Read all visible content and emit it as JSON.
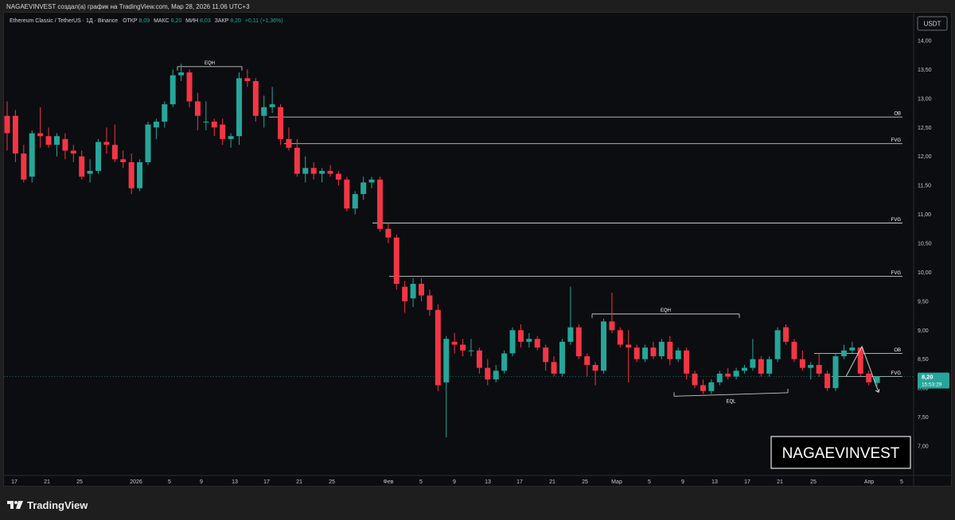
{
  "header": {
    "text": "NAGAEVINVEST создал(а) график на TradingView.com, Мар 28, 2026 11:06 UTC+3"
  },
  "footer": {
    "brand": "TradingView"
  },
  "colors": {
    "up": "#26a69a",
    "down": "#f23645",
    "level": "#c8c8c8",
    "axis_text": "#c8c8c8",
    "background": "#0c0d10",
    "price_badge": "#26a69a"
  },
  "chart_data": {
    "type": "candlestick",
    "legend": {
      "symbol": "Ethereum Classic / TetherUS · 1Д · Binance",
      "open_label": "ОТКР",
      "open": "8,09",
      "high_label": "МАКС",
      "high": "8,20",
      "low_label": "МИН",
      "low": "8,03",
      "close_label": "ЗАКР",
      "close": "8,20",
      "change": "+0,11 (+1,36%)"
    },
    "currency_button": "USDT",
    "y_ticks": [
      "7,00",
      "7,50",
      "8,00",
      "8,50",
      "9,00",
      "9,50",
      "10,00",
      "10,50",
      "11,00",
      "11,50",
      "12,00",
      "12,50",
      "13,00",
      "13,50",
      "14,00"
    ],
    "x_ticks": [
      "17",
      "21",
      "25",
      "2026",
      "5",
      "9",
      "13",
      "17",
      "21",
      "25",
      "Фев",
      "5",
      "9",
      "13",
      "17",
      "21",
      "25",
      "Мар",
      "5",
      "9",
      "13",
      "17",
      "21",
      "25",
      "Апр",
      "5"
    ],
    "ylim": [
      6.7,
      14.15
    ],
    "current_price": "8,20",
    "countdown": "15:53:29",
    "watermark": "NAGAEVINVEST",
    "levels": [
      {
        "label": "OB",
        "price": 12.68
      },
      {
        "label": "FVG",
        "price": 12.22
      },
      {
        "label": "FVG",
        "price": 10.85
      },
      {
        "label": "FVG",
        "price": 9.93
      },
      {
        "label": "OB",
        "price": 8.6
      },
      {
        "label": "FVG",
        "price": 8.2
      }
    ],
    "markers": [
      {
        "label": "EQH",
        "y": 13.55
      },
      {
        "label": "EQH",
        "y": 9.28
      },
      {
        "label": "EQL",
        "y": 7.89
      }
    ],
    "candles": [
      {
        "o": 12.7,
        "h": 12.95,
        "l": 12.1,
        "c": 12.4
      },
      {
        "o": 12.7,
        "h": 12.8,
        "l": 11.9,
        "c": 12.05
      },
      {
        "o": 12.05,
        "h": 12.2,
        "l": 11.55,
        "c": 11.6
      },
      {
        "o": 11.65,
        "h": 12.45,
        "l": 11.55,
        "c": 12.4
      },
      {
        "o": 12.4,
        "h": 12.85,
        "l": 12.15,
        "c": 12.35
      },
      {
        "o": 12.35,
        "h": 12.5,
        "l": 12.15,
        "c": 12.2
      },
      {
        "o": 12.2,
        "h": 12.4,
        "l": 12.0,
        "c": 12.35
      },
      {
        "o": 12.3,
        "h": 12.4,
        "l": 11.95,
        "c": 12.1
      },
      {
        "o": 12.1,
        "h": 12.2,
        "l": 11.9,
        "c": 12.05
      },
      {
        "o": 12.0,
        "h": 12.1,
        "l": 11.6,
        "c": 11.65
      },
      {
        "o": 11.7,
        "h": 11.95,
        "l": 11.55,
        "c": 11.75
      },
      {
        "o": 11.75,
        "h": 12.3,
        "l": 11.7,
        "c": 12.25
      },
      {
        "o": 12.25,
        "h": 12.5,
        "l": 12.05,
        "c": 12.2
      },
      {
        "o": 12.2,
        "h": 12.55,
        "l": 11.9,
        "c": 11.95
      },
      {
        "o": 11.95,
        "h": 12.1,
        "l": 11.8,
        "c": 11.9
      },
      {
        "o": 11.9,
        "h": 12.05,
        "l": 11.35,
        "c": 11.45
      },
      {
        "o": 11.45,
        "h": 11.95,
        "l": 11.4,
        "c": 11.9
      },
      {
        "o": 11.9,
        "h": 12.6,
        "l": 11.85,
        "c": 12.55
      },
      {
        "o": 12.5,
        "h": 12.65,
        "l": 12.3,
        "c": 12.6
      },
      {
        "o": 12.6,
        "h": 12.95,
        "l": 12.5,
        "c": 12.9
      },
      {
        "o": 12.9,
        "h": 13.5,
        "l": 12.85,
        "c": 13.4
      },
      {
        "o": 13.4,
        "h": 13.6,
        "l": 13.3,
        "c": 13.45
      },
      {
        "o": 13.45,
        "h": 13.5,
        "l": 12.85,
        "c": 12.95
      },
      {
        "o": 12.95,
        "h": 13.1,
        "l": 12.45,
        "c": 12.7
      },
      {
        "o": 12.6,
        "h": 12.95,
        "l": 12.45,
        "c": 12.6
      },
      {
        "o": 12.6,
        "h": 12.65,
        "l": 12.35,
        "c": 12.5
      },
      {
        "o": 12.55,
        "h": 12.65,
        "l": 12.2,
        "c": 12.3
      },
      {
        "o": 12.3,
        "h": 12.4,
        "l": 12.15,
        "c": 12.35
      },
      {
        "o": 12.35,
        "h": 13.45,
        "l": 12.2,
        "c": 13.35
      },
      {
        "o": 13.35,
        "h": 13.5,
        "l": 13.2,
        "c": 13.3
      },
      {
        "o": 13.3,
        "h": 13.35,
        "l": 12.6,
        "c": 12.7
      },
      {
        "o": 12.7,
        "h": 13.05,
        "l": 12.5,
        "c": 12.85
      },
      {
        "o": 12.85,
        "h": 13.2,
        "l": 12.75,
        "c": 12.9
      },
      {
        "o": 12.85,
        "h": 12.9,
        "l": 12.2,
        "c": 12.3
      },
      {
        "o": 12.3,
        "h": 12.5,
        "l": 12.1,
        "c": 12.15
      },
      {
        "o": 12.15,
        "h": 12.3,
        "l": 11.65,
        "c": 11.7
      },
      {
        "o": 11.7,
        "h": 12.0,
        "l": 11.55,
        "c": 11.8
      },
      {
        "o": 11.8,
        "h": 11.9,
        "l": 11.6,
        "c": 11.7
      },
      {
        "o": 11.7,
        "h": 11.8,
        "l": 11.55,
        "c": 11.75
      },
      {
        "o": 11.75,
        "h": 11.85,
        "l": 11.65,
        "c": 11.7
      },
      {
        "o": 11.7,
        "h": 11.75,
        "l": 11.5,
        "c": 11.6
      },
      {
        "o": 11.6,
        "h": 11.65,
        "l": 11.05,
        "c": 11.1
      },
      {
        "o": 11.1,
        "h": 11.4,
        "l": 11.0,
        "c": 11.35
      },
      {
        "o": 11.35,
        "h": 11.65,
        "l": 11.25,
        "c": 11.55
      },
      {
        "o": 11.55,
        "h": 11.65,
        "l": 11.45,
        "c": 11.6
      },
      {
        "o": 11.6,
        "h": 11.65,
        "l": 10.7,
        "c": 10.75
      },
      {
        "o": 10.75,
        "h": 10.85,
        "l": 10.5,
        "c": 10.6
      },
      {
        "o": 10.6,
        "h": 10.65,
        "l": 9.7,
        "c": 9.8
      },
      {
        "o": 9.75,
        "h": 9.85,
        "l": 9.3,
        "c": 9.5
      },
      {
        "o": 9.55,
        "h": 9.9,
        "l": 9.4,
        "c": 9.8
      },
      {
        "o": 9.8,
        "h": 9.9,
        "l": 9.5,
        "c": 9.6
      },
      {
        "o": 9.6,
        "h": 9.7,
        "l": 9.25,
        "c": 9.35
      },
      {
        "o": 9.35,
        "h": 9.45,
        "l": 7.95,
        "c": 8.05
      },
      {
        "o": 8.1,
        "h": 8.9,
        "l": 7.15,
        "c": 8.85
      },
      {
        "o": 8.8,
        "h": 8.95,
        "l": 8.6,
        "c": 8.75
      },
      {
        "o": 8.75,
        "h": 8.85,
        "l": 8.55,
        "c": 8.65
      },
      {
        "o": 8.65,
        "h": 8.85,
        "l": 8.55,
        "c": 8.65
      },
      {
        "o": 8.65,
        "h": 8.7,
        "l": 8.25,
        "c": 8.35
      },
      {
        "o": 8.35,
        "h": 8.5,
        "l": 8.05,
        "c": 8.15
      },
      {
        "o": 8.15,
        "h": 8.4,
        "l": 8.1,
        "c": 8.3
      },
      {
        "o": 8.3,
        "h": 8.65,
        "l": 8.25,
        "c": 8.6
      },
      {
        "o": 8.6,
        "h": 9.05,
        "l": 8.55,
        "c": 9.0
      },
      {
        "o": 9.0,
        "h": 9.1,
        "l": 8.7,
        "c": 8.8
      },
      {
        "o": 8.8,
        "h": 8.95,
        "l": 8.7,
        "c": 8.85
      },
      {
        "o": 8.85,
        "h": 8.9,
        "l": 8.65,
        "c": 8.7
      },
      {
        "o": 8.7,
        "h": 8.75,
        "l": 8.3,
        "c": 8.45
      },
      {
        "o": 8.45,
        "h": 8.55,
        "l": 8.2,
        "c": 8.25
      },
      {
        "o": 8.25,
        "h": 8.85,
        "l": 8.2,
        "c": 8.8
      },
      {
        "o": 8.8,
        "h": 9.75,
        "l": 8.75,
        "c": 9.05
      },
      {
        "o": 9.05,
        "h": 9.1,
        "l": 8.5,
        "c": 8.55
      },
      {
        "o": 8.55,
        "h": 8.6,
        "l": 8.2,
        "c": 8.4
      },
      {
        "o": 8.4,
        "h": 8.45,
        "l": 8.05,
        "c": 8.3
      },
      {
        "o": 8.3,
        "h": 9.2,
        "l": 8.25,
        "c": 9.15
      },
      {
        "o": 9.15,
        "h": 9.65,
        "l": 8.95,
        "c": 9.0
      },
      {
        "o": 9.0,
        "h": 9.05,
        "l": 8.7,
        "c": 8.75
      },
      {
        "o": 8.75,
        "h": 9.0,
        "l": 8.1,
        "c": 8.7
      },
      {
        "o": 8.7,
        "h": 8.75,
        "l": 8.45,
        "c": 8.5
      },
      {
        "o": 8.5,
        "h": 8.75,
        "l": 8.45,
        "c": 8.7
      },
      {
        "o": 8.7,
        "h": 8.8,
        "l": 8.5,
        "c": 8.55
      },
      {
        "o": 8.55,
        "h": 8.85,
        "l": 8.5,
        "c": 8.8
      },
      {
        "o": 8.8,
        "h": 8.9,
        "l": 8.4,
        "c": 8.5
      },
      {
        "o": 8.5,
        "h": 8.7,
        "l": 8.45,
        "c": 8.65
      },
      {
        "o": 8.65,
        "h": 8.7,
        "l": 8.15,
        "c": 8.25
      },
      {
        "o": 8.25,
        "h": 8.3,
        "l": 8.0,
        "c": 8.05
      },
      {
        "o": 8.05,
        "h": 8.15,
        "l": 7.9,
        "c": 7.95
      },
      {
        "o": 7.95,
        "h": 8.15,
        "l": 7.9,
        "c": 8.1
      },
      {
        "o": 8.1,
        "h": 8.3,
        "l": 8.05,
        "c": 8.25
      },
      {
        "o": 8.25,
        "h": 8.35,
        "l": 8.15,
        "c": 8.2
      },
      {
        "o": 8.2,
        "h": 8.35,
        "l": 8.15,
        "c": 8.3
      },
      {
        "o": 8.3,
        "h": 8.4,
        "l": 8.25,
        "c": 8.35
      },
      {
        "o": 8.35,
        "h": 8.85,
        "l": 8.3,
        "c": 8.5
      },
      {
        "o": 8.5,
        "h": 8.55,
        "l": 8.2,
        "c": 8.25
      },
      {
        "o": 8.25,
        "h": 8.55,
        "l": 8.2,
        "c": 8.5
      },
      {
        "o": 8.5,
        "h": 9.05,
        "l": 8.45,
        "c": 9.0
      },
      {
        "o": 9.05,
        "h": 9.1,
        "l": 8.75,
        "c": 8.8
      },
      {
        "o": 8.8,
        "h": 8.85,
        "l": 8.45,
        "c": 8.5
      },
      {
        "o": 8.5,
        "h": 8.65,
        "l": 8.3,
        "c": 8.35
      },
      {
        "o": 8.35,
        "h": 8.45,
        "l": 8.15,
        "c": 8.4
      },
      {
        "o": 8.4,
        "h": 8.6,
        "l": 8.2,
        "c": 8.25
      },
      {
        "o": 8.25,
        "h": 8.3,
        "l": 7.95,
        "c": 8.0
      },
      {
        "o": 8.0,
        "h": 8.6,
        "l": 7.95,
        "c": 8.55
      },
      {
        "o": 8.55,
        "h": 8.75,
        "l": 8.5,
        "c": 8.65
      },
      {
        "o": 8.65,
        "h": 8.8,
        "l": 8.6,
        "c": 8.7
      },
      {
        "o": 8.7,
        "h": 8.7,
        "l": 8.2,
        "c": 8.25
      },
      {
        "o": 8.25,
        "h": 8.3,
        "l": 8.05,
        "c": 8.1
      },
      {
        "o": 8.09,
        "h": 8.2,
        "l": 8.03,
        "c": 8.2
      }
    ]
  }
}
